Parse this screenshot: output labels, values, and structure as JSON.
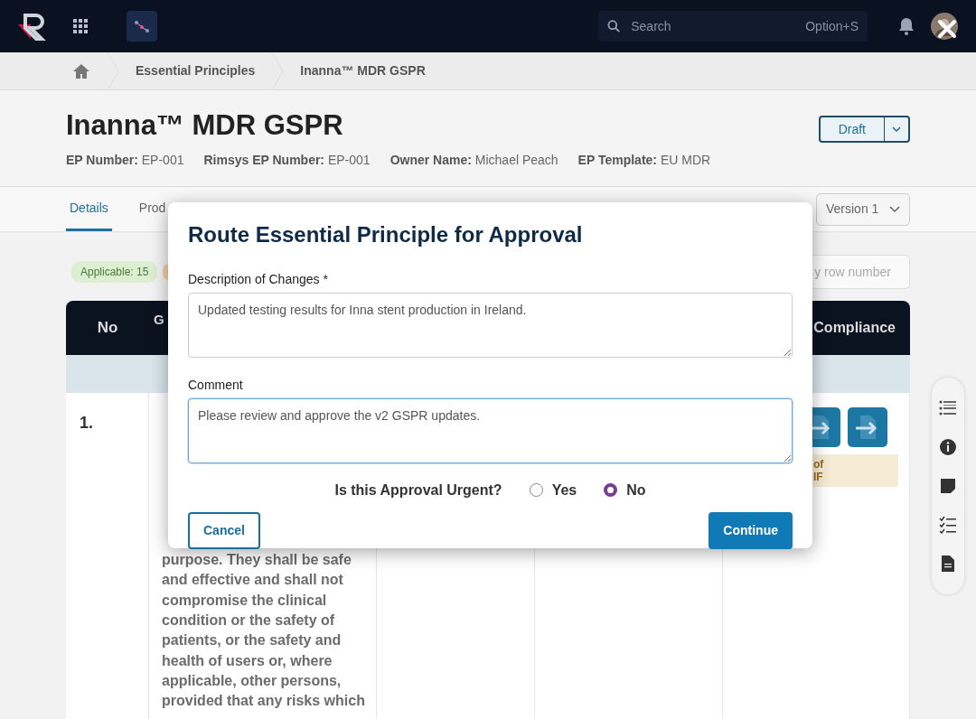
{
  "top_bar": {
    "search": {
      "placeholder": "Search",
      "shortcut": "Option+S"
    }
  },
  "breadcrumb": [
    {
      "label": "Essential Principles"
    },
    {
      "label": "Inanna™ MDR GSPR"
    }
  ],
  "header": {
    "title": "Inanna™ MDR GSPR",
    "status_button": "Draft",
    "fields": [
      {
        "label": "EP Number:",
        "value": "EP-001"
      },
      {
        "label": "Rimsys EP Number:",
        "value": "EP-001"
      },
      {
        "label": "Owner Name:",
        "value": "Michael Peach"
      },
      {
        "label": "EP Template:",
        "value": "EU MDR"
      }
    ]
  },
  "tabs": [
    {
      "label": "Details",
      "selected": true
    },
    {
      "label": "Prod",
      "selected": false
    }
  ],
  "version_select": "Version 1",
  "filters": {
    "badge": "Applicable: 15",
    "row_search": {
      "placeholder": "y row number"
    }
  },
  "table": {
    "columns": [
      "No",
      "G",
      "Compliance"
    ],
    "rows": [
      {
        "number": "1.",
        "text": "purpose. They shall be safe and effective and shall not compromise the clinical condition or the safety of patients, or the safety and health of users or, where applicable, other persons, provided that any risks which",
        "note": [
          "of",
          "IF"
        ]
      }
    ]
  },
  "modal": {
    "title": "Route Essential Principle for Approval",
    "fields": [
      {
        "label": "Description of Changes *",
        "value": "Updated testing results for Inna stent production in Ireland.",
        "focused": false
      },
      {
        "label": "Comment",
        "value": "Please review and approve the v2 GSPR updates.",
        "focused": true
      }
    ],
    "question": "Is this Approval Urgent?",
    "options": [
      {
        "label": "Yes",
        "selected": false
      },
      {
        "label": "No",
        "selected": true
      }
    ],
    "buttons": [
      {
        "label": "Cancel",
        "kind": "secondary"
      },
      {
        "label": "Continue",
        "kind": "primary"
      }
    ]
  }
}
